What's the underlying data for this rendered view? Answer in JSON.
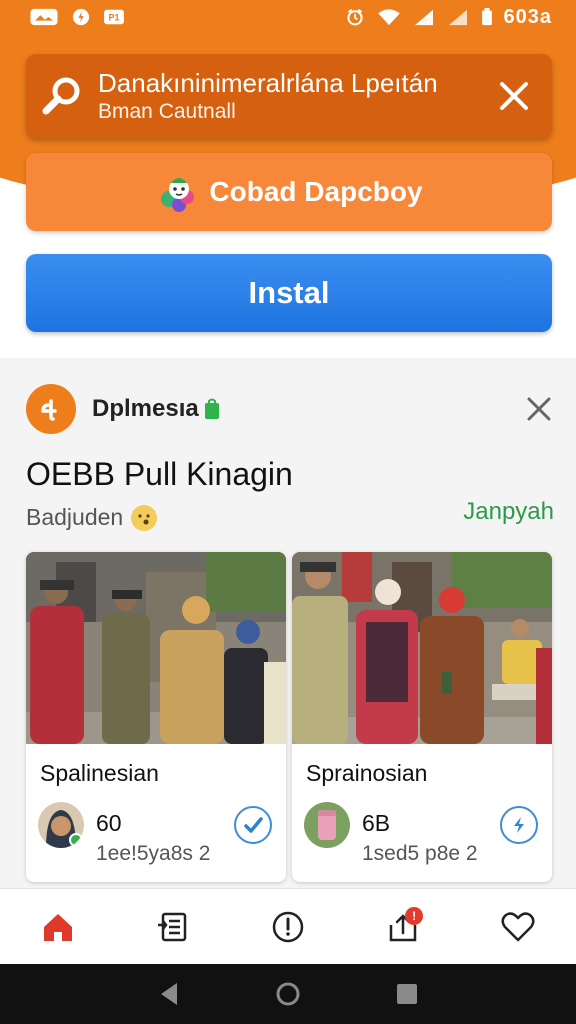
{
  "status_bar": {
    "time": "603a",
    "left_icons": [
      "photo-icon",
      "notification-icon",
      "sim-icon"
    ],
    "right_icons": [
      "alarm-icon",
      "wifi-icon",
      "signal-icon",
      "signal-icon",
      "battery-icon"
    ]
  },
  "search_bar": {
    "title": "Danakıninimeralrlána Lpeıtán",
    "subtitle": "Bman Cautnall",
    "icon": "search-icon",
    "close_icon": "close-icon"
  },
  "primary_actions": {
    "orange_button_label": "Cobad Dapcboy",
    "install_button_label": "Instal"
  },
  "feed": {
    "channel_name": "Dplmesıa",
    "post_title": "OEBB Pull Kinagin",
    "post_subtitle": "Badjuden",
    "post_link": "Janpyah",
    "tiles": [
      {
        "title": "Spalinesian",
        "count": "60",
        "meta": "1ee!5ya8s 2",
        "action_icon": "check-icon"
      },
      {
        "title": "Sprainosian",
        "count": "6B",
        "meta": "1sed5 p8e 2",
        "action_icon": "bolt-icon"
      }
    ]
  },
  "bottom_nav": {
    "items": [
      "home-icon",
      "list-icon",
      "alert-icon",
      "share-icon",
      "heart-icon"
    ],
    "badge": "!"
  },
  "colors": {
    "header_orange": "#ee7d1c",
    "search_bar": "#d5600f",
    "orange_button": "#f7883a",
    "install_button": "#2a80ea",
    "link_green": "#2d9a4b",
    "home_active": "#e0392b"
  }
}
